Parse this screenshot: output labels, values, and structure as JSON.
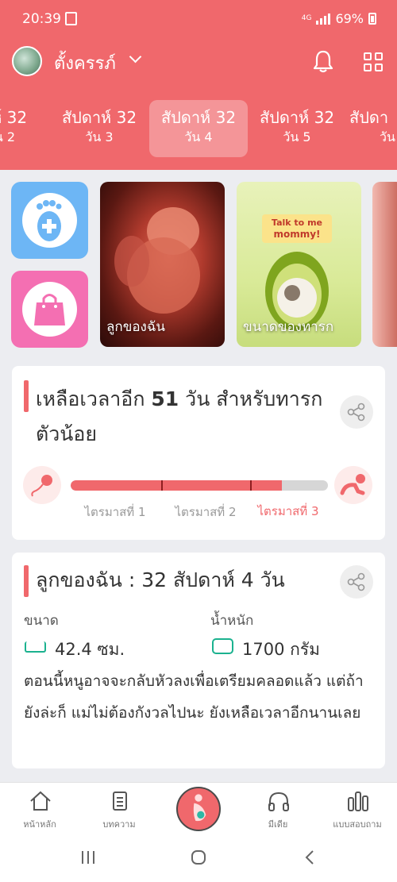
{
  "status": {
    "time": "20:39",
    "battery": "69%",
    "network": "4G"
  },
  "profile": {
    "name": "ตั้งครรภ์"
  },
  "icons": {
    "bell": "bell-icon",
    "grid": "grid-menu-icon",
    "share": "share-icon",
    "ruler": "ruler-icon",
    "scale": "scale-icon"
  },
  "day_tabs": [
    {
      "week": "าห์ 32",
      "day": "น 2"
    },
    {
      "week": "สัปดาห์ 32",
      "day": "วัน 3"
    },
    {
      "week": "สัปดาห์ 32",
      "day": "วัน 4"
    },
    {
      "week": "สัปดาห์ 32",
      "day": "วัน 5"
    },
    {
      "week": "สัปดา",
      "day": "วัน"
    }
  ],
  "cards": [
    {
      "caption": "ลูกของฉัน"
    },
    {
      "caption": "ขนาดของทารก",
      "bubble_line1": "Talk to me",
      "bubble_line2": "mommy!"
    }
  ],
  "countdown": {
    "prefix": "เหลือเวลาอีก ",
    "days": "51",
    "suffix": " วัน สำหรับทารกตัวน้อย",
    "progress_fraction": 0.82,
    "trimesters": [
      "ไตรมาสที่ 1",
      "ไตรมาสที่ 2",
      "ไตรมาสที่ 3"
    ]
  },
  "baby": {
    "title": "ลูกของฉัน : 32 สัปดาห์ 4  วัน",
    "size_label": "ขนาด",
    "size_value": "42.4 ซม.",
    "weight_label": "น้ำหนัก",
    "weight_value": "1700 กรัม",
    "description": "ตอนนี้หนูอาจจะกลับหัวลงเพื่อเตรียมคลอดแล้ว แต่ถ้ายังล่ะก็ แม่ไม่ต้องกังวลไปนะ ยังเหลือเวลาอีกนานเลย"
  },
  "nav": [
    {
      "label": "หน้าหลัก",
      "icon": "home-icon"
    },
    {
      "label": "บทความ",
      "icon": "article-icon"
    },
    {
      "label": "",
      "icon": "pregnancy-icon"
    },
    {
      "label": "มีเดีย",
      "icon": "headphones-icon"
    },
    {
      "label": "แบบสอบถาม",
      "icon": "poll-icon"
    }
  ],
  "colors": {
    "brand": "#f0686c",
    "background": "#ecedf1",
    "foot_button": "#6db6f5",
    "bag_button": "#f46fb2",
    "metric_icon": "#1bb28f"
  }
}
